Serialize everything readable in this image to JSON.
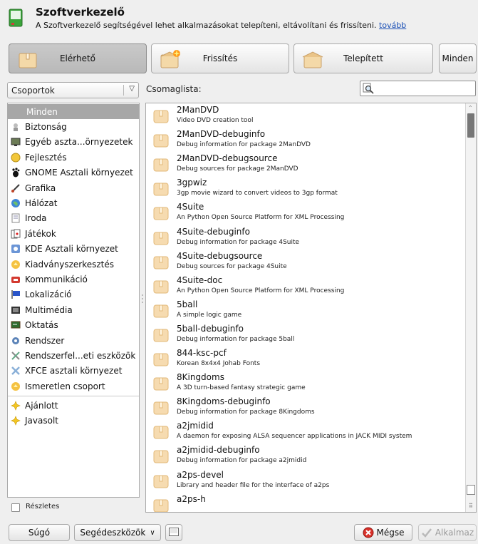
{
  "header": {
    "title": "Szoftverkezelő",
    "description": "A Szoftverkezelő segítségével lehet alkalmazásokat telepíteni, eltávolítani és frissíteni.",
    "more_link": "tovább"
  },
  "tabs": [
    {
      "label": "Elérhető",
      "icon": "box-icon",
      "active": true
    },
    {
      "label": "Frissítés",
      "icon": "box-update-icon",
      "active": false
    },
    {
      "label": "Telepített",
      "icon": "box-installed-icon",
      "active": false
    },
    {
      "label": "Minden",
      "active": false
    }
  ],
  "groups_combo": {
    "value": "Csoportok"
  },
  "package_list_label": "Csomaglista:",
  "search": {
    "placeholder": ""
  },
  "groups": [
    {
      "label": "Minden",
      "selected": true,
      "icon": ""
    },
    {
      "label": "Biztonság",
      "icon": "security-icon"
    },
    {
      "label": "Egyéb aszta...örnyezetek",
      "icon": "desktop-icon"
    },
    {
      "label": "Fejlesztés",
      "icon": "development-icon"
    },
    {
      "label": "GNOME Asztali környezet",
      "icon": "gnome-icon"
    },
    {
      "label": "Grafika",
      "icon": "graphics-icon"
    },
    {
      "label": "Hálózat",
      "icon": "network-icon"
    },
    {
      "label": "Iroda",
      "icon": "office-icon"
    },
    {
      "label": "Játékok",
      "icon": "games-icon"
    },
    {
      "label": "KDE Asztali környezet",
      "icon": "kde-icon"
    },
    {
      "label": "Kiadványszerkesztés",
      "icon": "publishing-icon"
    },
    {
      "label": "Kommunikáció",
      "icon": "communication-icon"
    },
    {
      "label": "Lokalizáció",
      "icon": "localization-icon"
    },
    {
      "label": "Multimédia",
      "icon": "multimedia-icon"
    },
    {
      "label": "Oktatás",
      "icon": "education-icon"
    },
    {
      "label": "Rendszer",
      "icon": "system-icon"
    },
    {
      "label": "Rendszerfel...eti eszközök",
      "icon": "admin-tools-icon"
    },
    {
      "label": "XFCE asztali környezet",
      "icon": "xfce-icon"
    },
    {
      "label": "Ismeretlen csoport",
      "icon": "unknown-group-icon"
    },
    {
      "label": "Ajánlott",
      "icon": "star-icon"
    },
    {
      "label": "Javasolt",
      "icon": "star-icon"
    }
  ],
  "packages": [
    {
      "name": "2ManDVD",
      "desc": "Video DVD creation tool"
    },
    {
      "name": "2ManDVD-debuginfo",
      "desc": "Debug information for package 2ManDVD"
    },
    {
      "name": "2ManDVD-debugsource",
      "desc": "Debug sources for package 2ManDVD"
    },
    {
      "name": "3gpwiz",
      "desc": "3gp movie wizard to convert videos to 3gp format"
    },
    {
      "name": "4Suite",
      "desc": "An Python Open Source Platform for XML Processing"
    },
    {
      "name": "4Suite-debuginfo",
      "desc": "Debug information for package 4Suite"
    },
    {
      "name": "4Suite-debugsource",
      "desc": "Debug sources for package 4Suite"
    },
    {
      "name": "4Suite-doc",
      "desc": "An Python Open Source Platform for XML Processing"
    },
    {
      "name": "5ball",
      "desc": "A simple logic game"
    },
    {
      "name": "5ball-debuginfo",
      "desc": "Debug information for package 5ball"
    },
    {
      "name": "844-ksc-pcf",
      "desc": "Korean 8x4x4 Johab Fonts"
    },
    {
      "name": "8Kingdoms",
      "desc": "A 3D turn-based fantasy strategic game"
    },
    {
      "name": "8Kingdoms-debuginfo",
      "desc": "Debug information for package 8Kingdoms"
    },
    {
      "name": "a2jmidid",
      "desc": "A daemon for exposing ALSA sequencer applications in JACK MIDI system"
    },
    {
      "name": "a2jmidid-debuginfo",
      "desc": "Debug information for package a2jmidid"
    },
    {
      "name": "a2ps-devel",
      "desc": "Library and header file for the interface of a2ps"
    },
    {
      "name": "a2ps-h",
      "desc": ""
    }
  ],
  "details_checkbox": {
    "label": "Részletes",
    "checked": false
  },
  "bottom": {
    "help": "Súgó",
    "tools": "Segédeszközök",
    "cancel": "Mégse",
    "apply": "Alkalmaz"
  },
  "colors": {
    "selected_group_bg": "#a7a7a7",
    "link": "#1a4fb5",
    "cancel_icon": "#d9312a"
  }
}
